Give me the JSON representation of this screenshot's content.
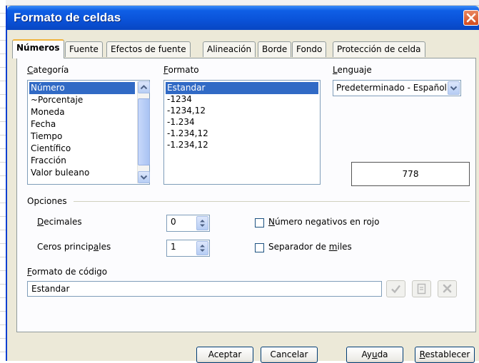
{
  "dialog": {
    "title": "Formato de celdas"
  },
  "tabs": [
    {
      "label": "Números",
      "active": true
    },
    {
      "label": "Fuente"
    },
    {
      "label": "Efectos de fuente"
    },
    {
      "label": "Alineación"
    },
    {
      "label": "Borde"
    },
    {
      "label": "Fondo"
    },
    {
      "label": "Protección de celda"
    }
  ],
  "category": {
    "label_pre": "",
    "label_u": "C",
    "label_post": "ategoría",
    "items": [
      "Número",
      "~Porcentaje",
      "Moneda",
      "Fecha",
      "Tiempo",
      "Científico",
      "Fracción",
      "Valor buleano"
    ],
    "selected_index": 0
  },
  "format": {
    "label_pre": "",
    "label_u": "F",
    "label_post": "ormato",
    "items": [
      "Estandar",
      "-1234",
      "-1234,12",
      "-1.234",
      "-1.234,12",
      "-1.234,12"
    ],
    "selected_index": 0
  },
  "language": {
    "label_pre": "",
    "label_u": "L",
    "label_post": "enguaje",
    "value": "Predeterminado - Español"
  },
  "preview": {
    "value": "778"
  },
  "options": {
    "heading": "Opciones",
    "decimals": {
      "label_pre": "",
      "label_u": "D",
      "label_post": "ecimales",
      "value": "0"
    },
    "leading_zeros": {
      "label_pre": "Ceros princip",
      "label_u": "a",
      "label_post": "les",
      "value": "1"
    },
    "negative_red": {
      "label_pre": "",
      "label_u": "N",
      "label_post": "úmero negativos en rojo",
      "checked": false
    },
    "thousands_sep": {
      "label_pre": "Separador de ",
      "label_u": "m",
      "label_post": "iles",
      "checked": false
    }
  },
  "code_format": {
    "label_pre": "",
    "label_u": "F",
    "label_post": "ormato de código",
    "value": "Estandar"
  },
  "buttons": {
    "accept": {
      "label": "Aceptar"
    },
    "cancel": {
      "label": "Cancelar"
    },
    "help": {
      "label_pre": "Ay",
      "label_u": "u",
      "label_post": "da"
    },
    "reset": {
      "label_pre": "",
      "label_u": "R",
      "label_post": "establecer"
    }
  },
  "colors": {
    "titlebar": "#0a52d8",
    "selection": "#316ac5",
    "dialog_bg": "#ece9d8",
    "close_button": "#d44a1f"
  },
  "icons": [
    "close-icon",
    "scroll-up-arrow-icon",
    "scroll-down-arrow-icon",
    "dropdown-arrow-icon",
    "spin-arrows-icon",
    "checkmark-icon",
    "comment-icon",
    "delete-x-icon"
  ]
}
